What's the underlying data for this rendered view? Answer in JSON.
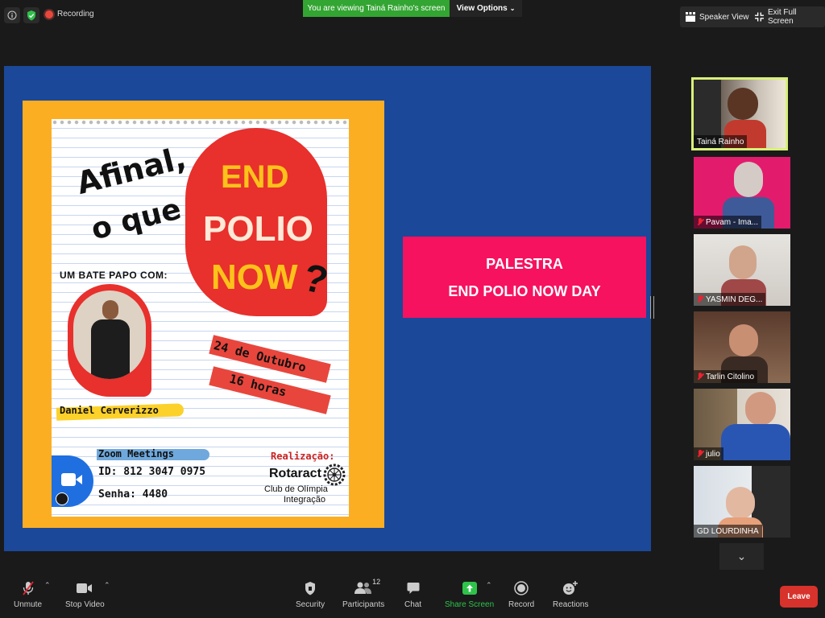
{
  "topbar": {
    "recording_label": "Recording",
    "viewing_text": "You are viewing Tainá Rainho's screen",
    "view_options_label": "View Options",
    "speaker_view_label": "Speaker View",
    "exit_full_screen_label": "Exit Full Screen"
  },
  "poster": {
    "headline_1": "Afinal,",
    "headline_2": "o que é",
    "end": "END",
    "polio": "POLIO",
    "now": "NOW",
    "qmark": "?",
    "chat_with": "UM BATE PAPO COM:",
    "speaker_name": "Daniel Cerverizzo",
    "date": "24 de Outubro",
    "time": "16 horas",
    "zoom_meetings": "Zoom Meetings",
    "meeting_id": "ID: 812 3047 0975",
    "password": "Senha: 4480",
    "realizacao": "Realização:",
    "org_name": "Rotaract",
    "org_line1": "Club de Olímpia",
    "org_line2": "Integração"
  },
  "banner": {
    "line1": "PALESTRA",
    "line2": "END POLIO NOW DAY"
  },
  "participants": [
    {
      "name": "Tainá Rainho",
      "muted": false
    },
    {
      "name": "Pavam - Ima...",
      "muted": true
    },
    {
      "name": "YASMIN DEG...",
      "muted": true
    },
    {
      "name": "Tarlin Citolino",
      "muted": true
    },
    {
      "name": "julio",
      "muted": true
    },
    {
      "name": "GD LOURDINHA",
      "muted": false
    }
  ],
  "toolbar": {
    "unmute": "Unmute",
    "stop_video": "Stop Video",
    "security": "Security",
    "participants": "Participants",
    "participants_count": "12",
    "chat": "Chat",
    "share_screen": "Share Screen",
    "record": "Record",
    "reactions": "Reactions",
    "leave": "Leave"
  },
  "colors": {
    "share_bg": "#1b4899",
    "poster_border": "#fcae22",
    "banner": "#f6125e",
    "viewing_green": "#33a532",
    "leave_red": "#d7322b"
  }
}
